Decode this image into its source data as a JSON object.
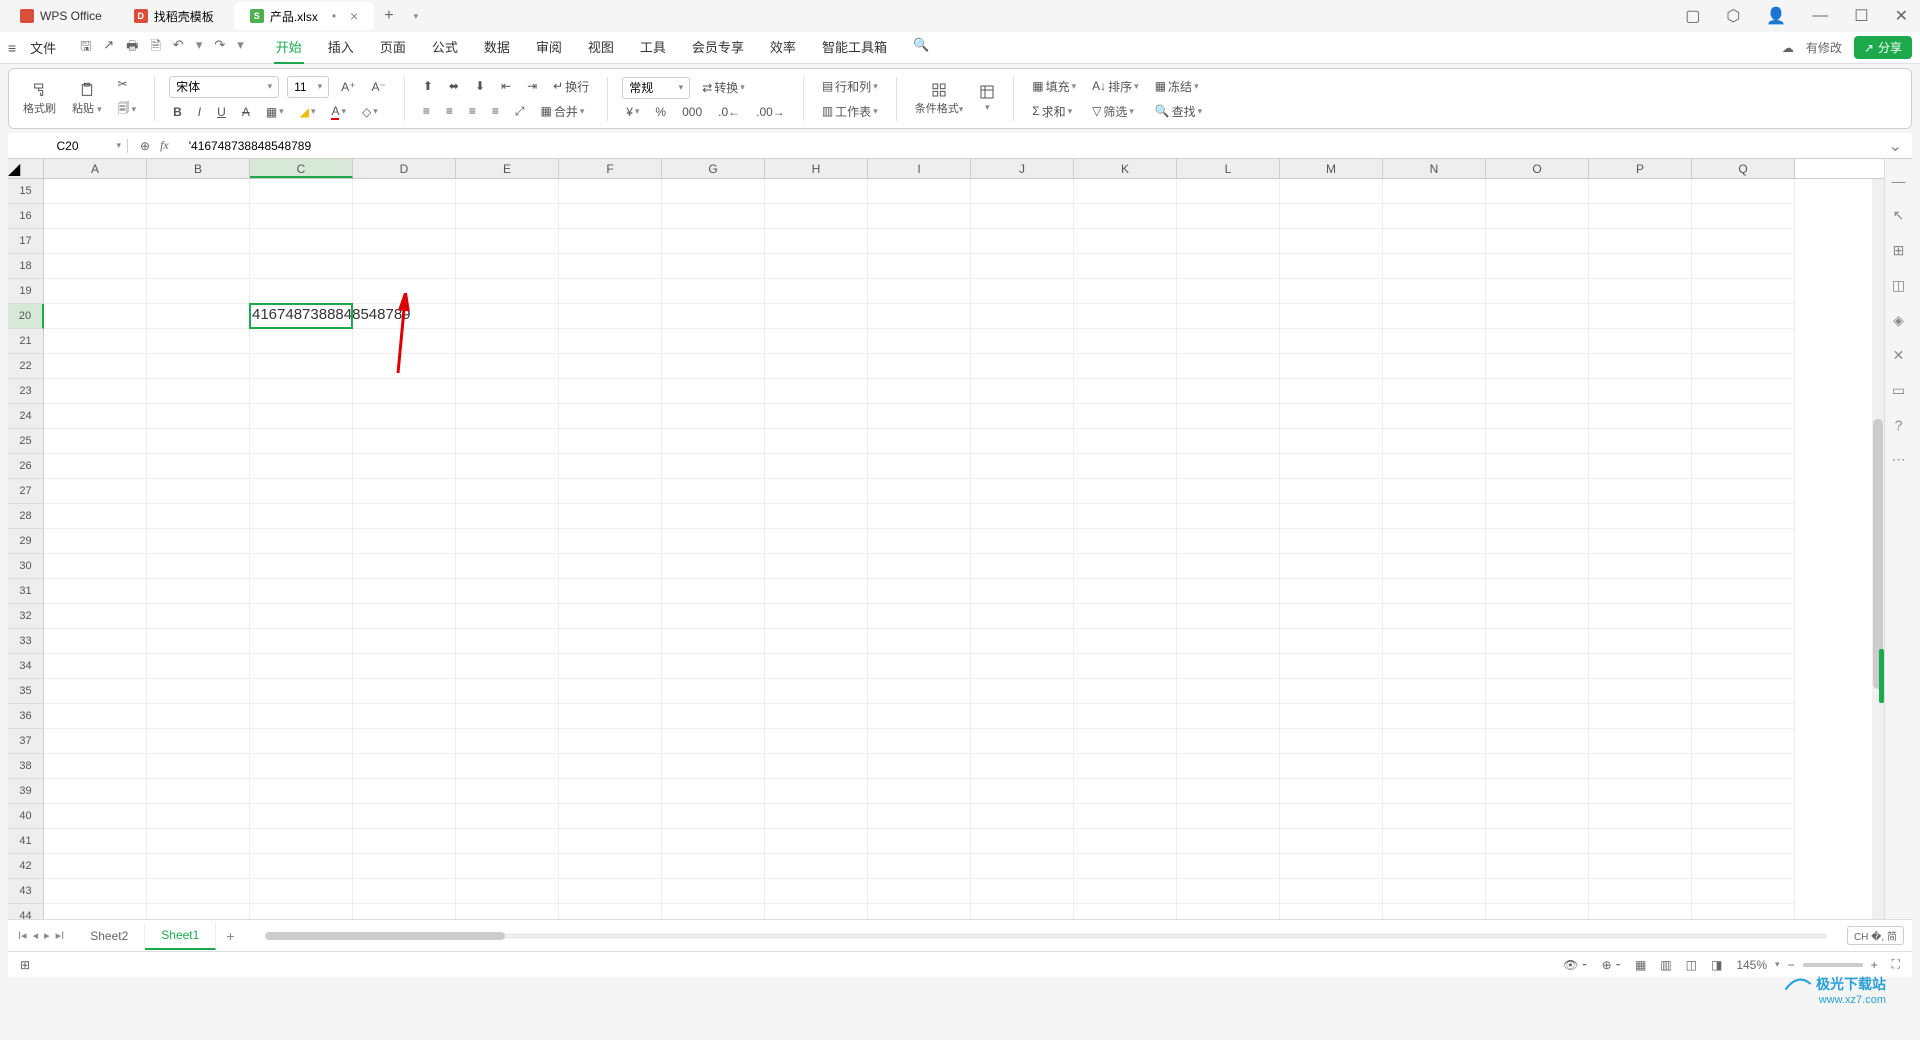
{
  "app": {
    "name": "WPS Office"
  },
  "tabs": [
    {
      "icon": "red",
      "label": "找稻壳模板"
    },
    {
      "icon": "green",
      "letter": "S",
      "label": "产品.xlsx",
      "modified": true
    }
  ],
  "menubar": {
    "file": "文件",
    "items": [
      "开始",
      "插入",
      "页面",
      "公式",
      "数据",
      "审阅",
      "视图",
      "工具",
      "会员专享",
      "效率",
      "智能工具箱"
    ],
    "active": "开始",
    "modify_notice": "有修改",
    "share": "分享"
  },
  "ribbon": {
    "format_brush": "格式刷",
    "paste": "粘贴",
    "font_name": "宋体",
    "font_size": "11",
    "wrap": "换行",
    "merge": "合并",
    "number_format": "常规",
    "convert": "转换",
    "rowcol": "行和列",
    "worksheet": "工作表",
    "cond_format": "条件格式",
    "fill": "填充",
    "sort": "排序",
    "freeze": "冻结",
    "sum": "求和",
    "filter": "筛选",
    "find": "查找"
  },
  "namebox": "C20",
  "formula": "'416748738848548789",
  "columns": [
    "A",
    "B",
    "C",
    "D",
    "E",
    "F",
    "G",
    "H",
    "I",
    "J",
    "K",
    "L",
    "M",
    "N",
    "O",
    "P",
    "Q"
  ],
  "row_start": 15,
  "row_end": 44,
  "selected_col": "C",
  "selected_row": 20,
  "cell_data": {
    "C20": "4167487388848548789"
  },
  "sheets": {
    "items": [
      "Sheet2",
      "Sheet1"
    ],
    "active": "Sheet1"
  },
  "ime": "CH �, 简",
  "status": {
    "zoom": "145%"
  },
  "watermark": {
    "cn": "极光下载站",
    "en": "www.xz7.com"
  }
}
